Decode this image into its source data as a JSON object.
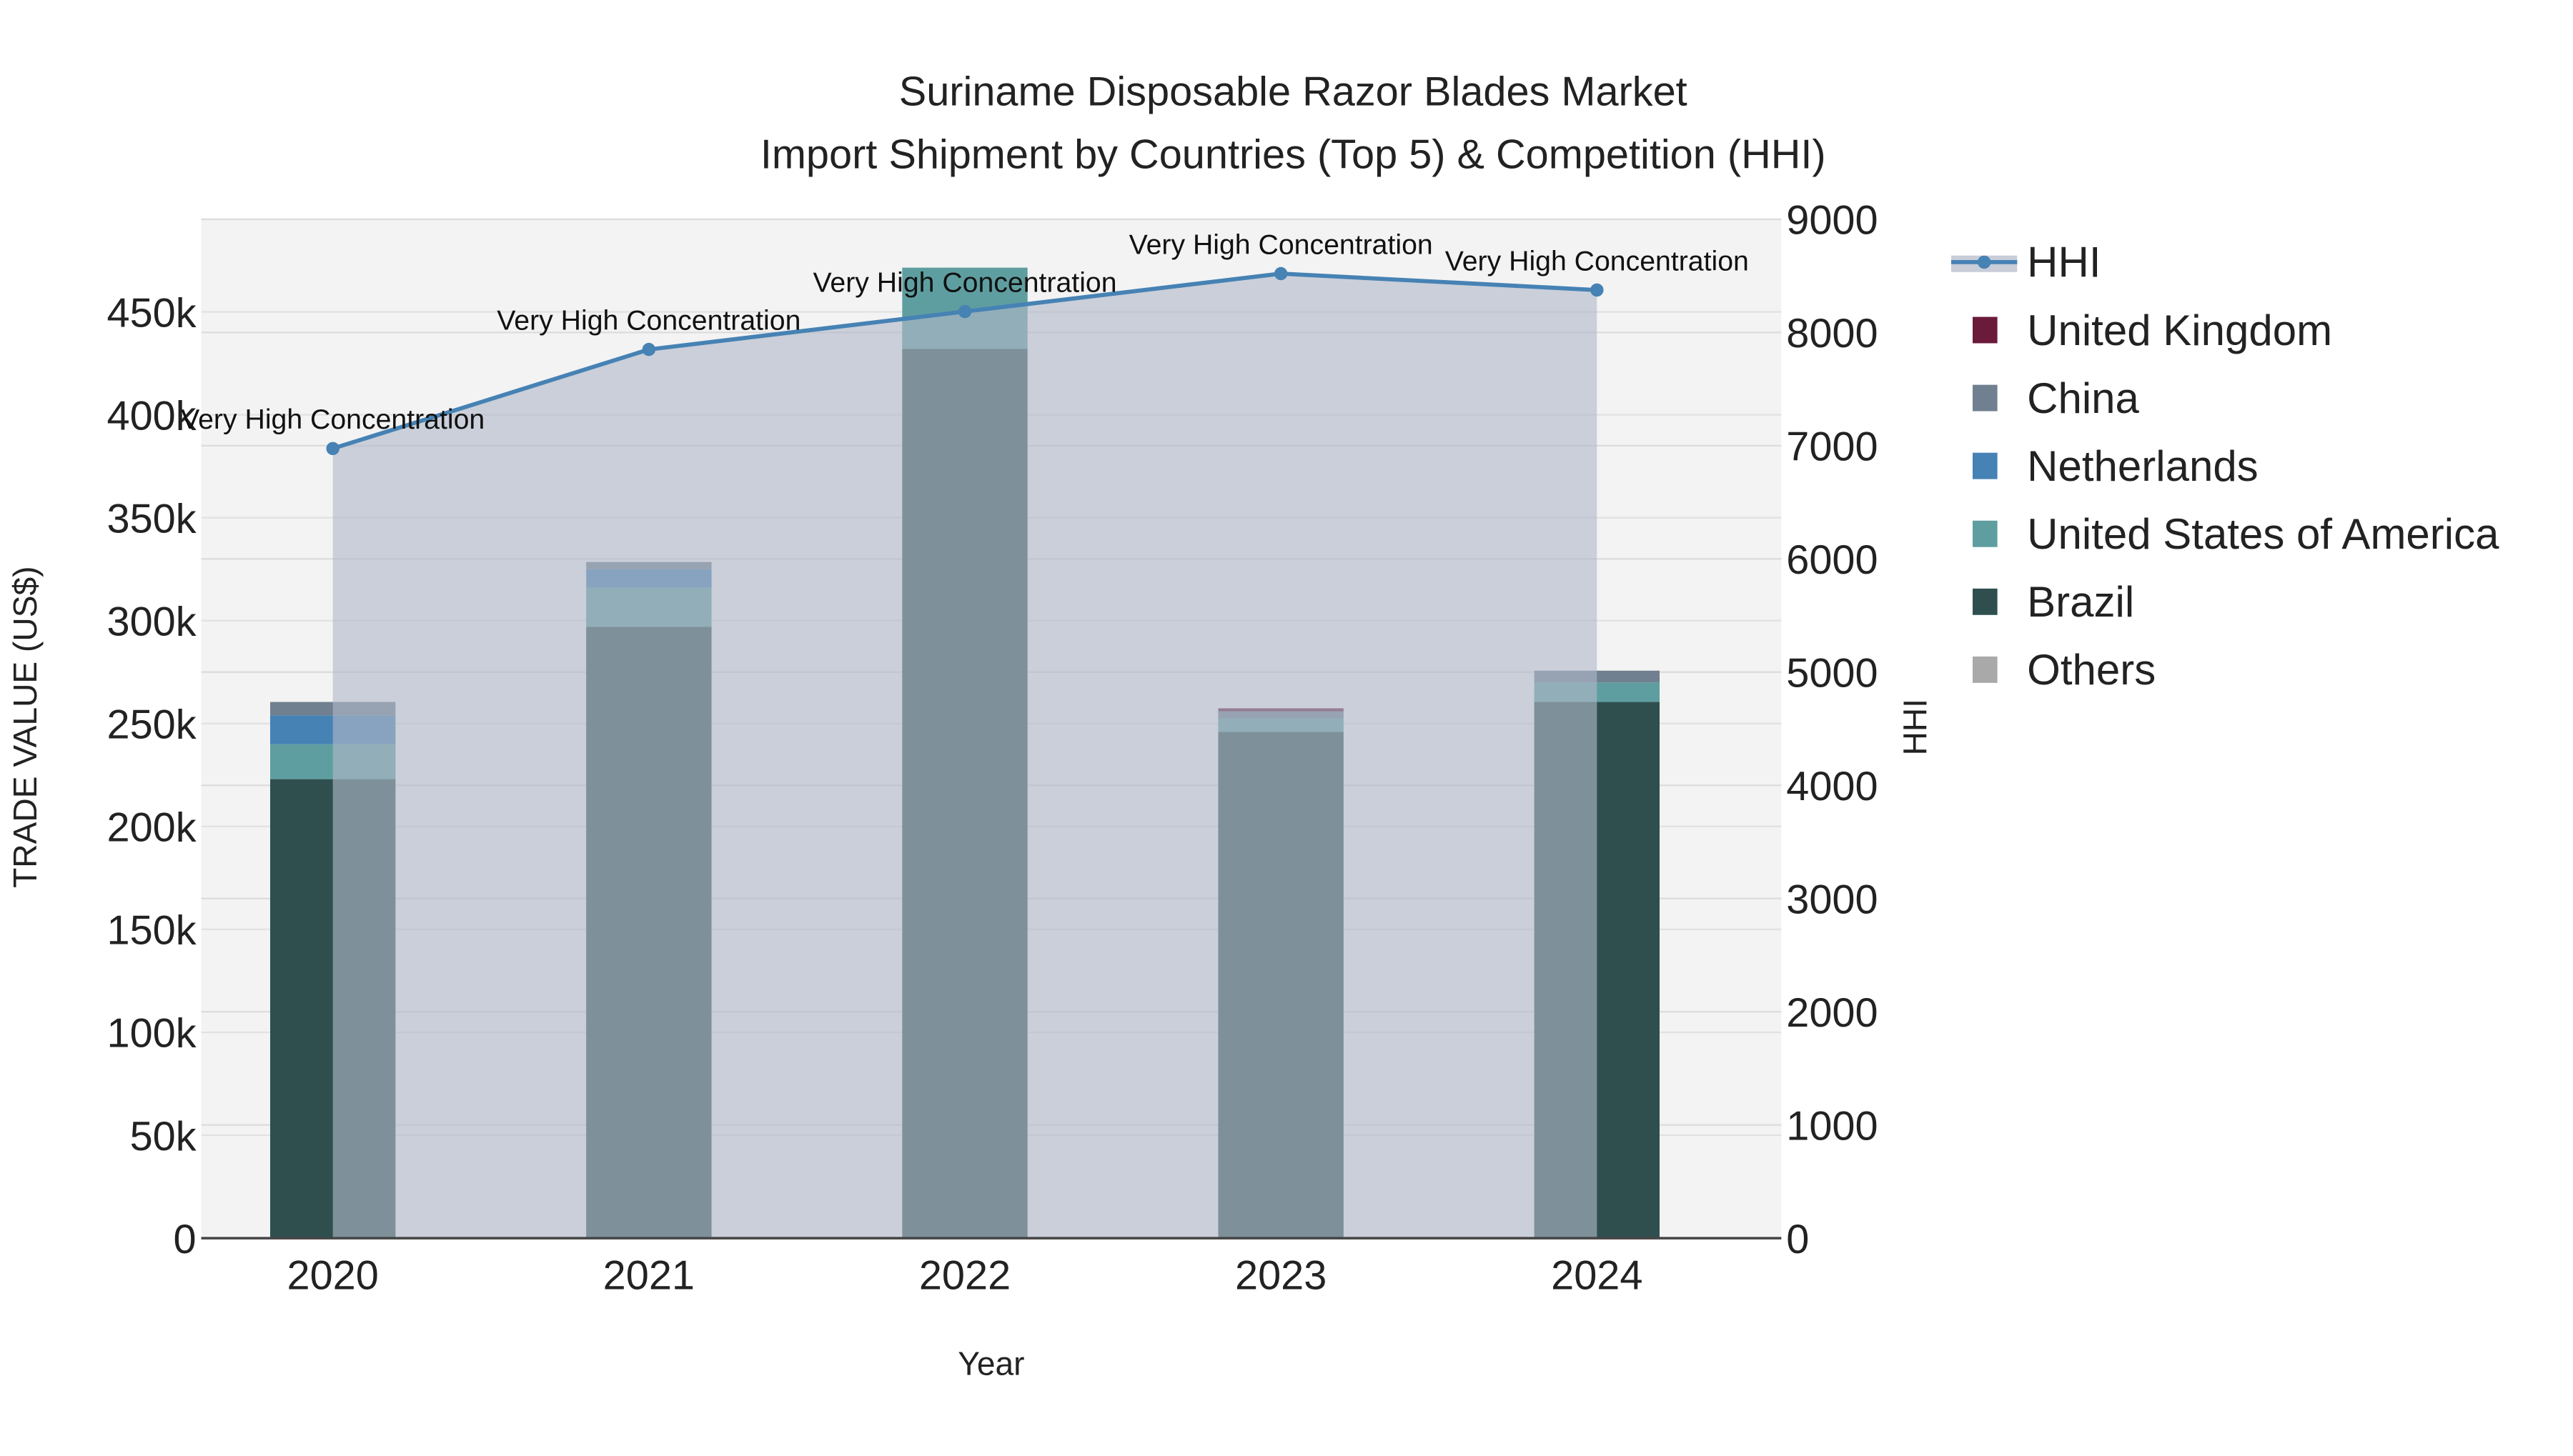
{
  "chart_data": {
    "type": "bar",
    "title": "Suriname Disposable Razor Blades Market",
    "subtitle": "Import Shipment by Countries (Top 5) & Competition (HHI)",
    "xlabel": "Year",
    "ylabel": "TRADE VALUE (US$)",
    "y2label": "HHI",
    "categories": [
      "2020",
      "2021",
      "2022",
      "2023",
      "2024"
    ],
    "ylim": [
      0,
      495000
    ],
    "y2lim": [
      0,
      9000
    ],
    "yticks": [
      0,
      50000,
      100000,
      150000,
      200000,
      250000,
      300000,
      350000,
      400000,
      450000
    ],
    "ytick_labels": [
      "0",
      "50k",
      "100k",
      "150k",
      "200k",
      "250k",
      "300k",
      "350k",
      "400k",
      "450k"
    ],
    "y2ticks": [
      0,
      1000,
      2000,
      3000,
      4000,
      5000,
      6000,
      7000,
      8000,
      9000
    ],
    "y2tick_labels": [
      "0",
      "1000",
      "2000",
      "3000",
      "4000",
      "5000",
      "6000",
      "7000",
      "8000",
      "9000"
    ],
    "series": [
      {
        "name": "Brazil",
        "color": "#2F4F4F",
        "values": [
          223000,
          297000,
          432000,
          246000,
          260500
        ]
      },
      {
        "name": "United States of America",
        "color": "#5F9EA0",
        "values": [
          17000,
          19000,
          39500,
          6500,
          9500
        ]
      },
      {
        "name": "Netherlands",
        "color": "#4682B4",
        "values": [
          14000,
          9000,
          0,
          0,
          0
        ]
      },
      {
        "name": "China",
        "color": "#708090",
        "values": [
          6500,
          3500,
          0,
          3500,
          5700
        ]
      },
      {
        "name": "United Kingdom",
        "color": "#6B1A3A",
        "values": [
          0,
          0,
          0,
          1400,
          0
        ]
      },
      {
        "name": "Others",
        "color": "#A9A9A9",
        "values": [
          0,
          0,
          0,
          0,
          0
        ]
      }
    ],
    "hhi": {
      "name": "HHI",
      "color": "#4682B4",
      "values": [
        6975,
        7850,
        8185,
        8520,
        8375
      ],
      "annotations": [
        "Very High Concentration",
        "Very High Concentration",
        "Very High Concentration",
        "Very High Concentration",
        "Very High Concentration"
      ]
    },
    "legend": [
      "HHI",
      "United Kingdom",
      "China",
      "Netherlands",
      "United States of America",
      "Brazil",
      "Others"
    ],
    "legend_position": "right",
    "grid": true
  }
}
